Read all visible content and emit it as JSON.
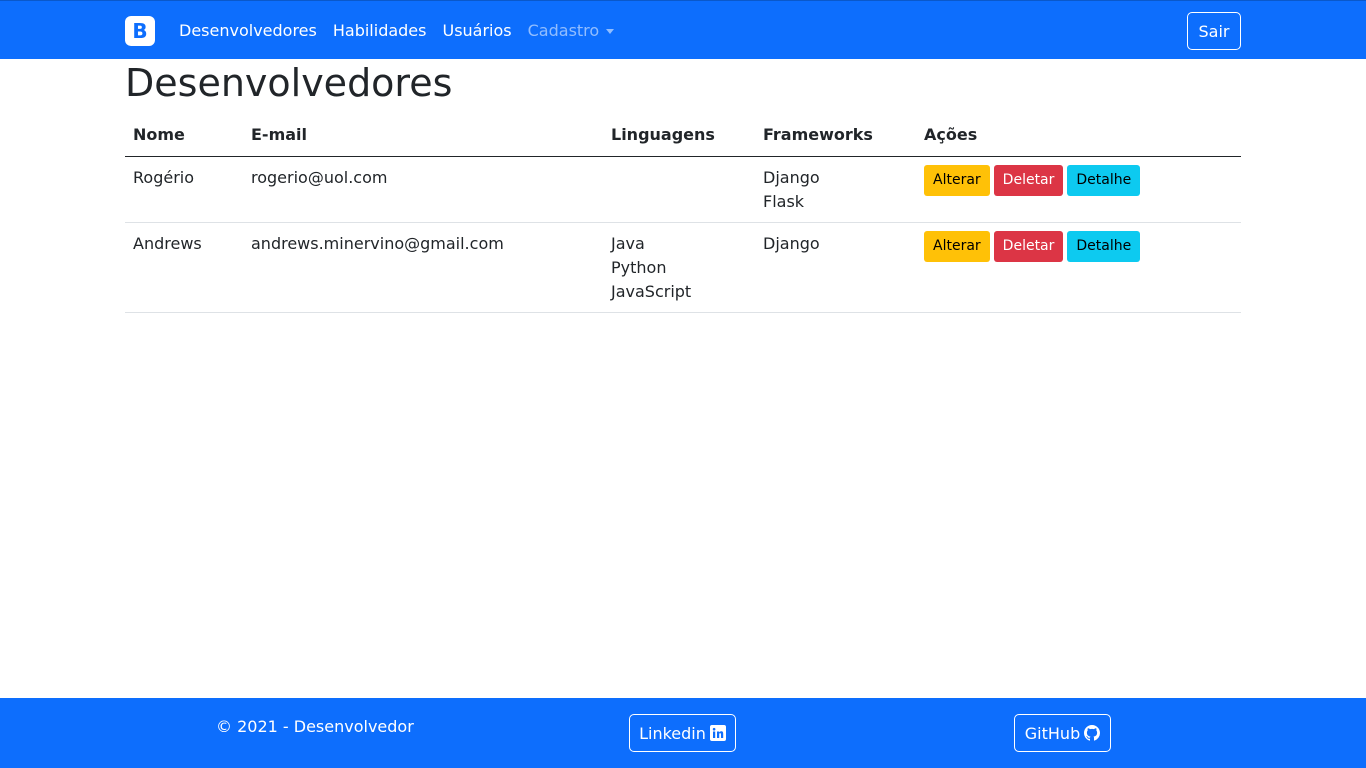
{
  "navbar": {
    "brand": "B",
    "links": [
      "Desenvolvedores",
      "Habilidades",
      "Usuários"
    ],
    "dropdown_label": "Cadastro",
    "logout_label": "Sair"
  },
  "page": {
    "title": "Desenvolvedores"
  },
  "table": {
    "headers": [
      "Nome",
      "E-mail",
      "Linguagens",
      "Frameworks",
      "Ações"
    ],
    "rows": [
      {
        "nome": "Rogério",
        "email": "rogerio@uol.com",
        "linguagens": [],
        "frameworks": [
          "Django",
          "Flask"
        ]
      },
      {
        "nome": "Andrews",
        "email": "andrews.minervino@gmail.com",
        "linguagens": [
          "Java",
          "Python",
          "JavaScript"
        ],
        "frameworks": [
          "Django"
        ]
      }
    ],
    "actions": {
      "edit": "Alterar",
      "delete": "Deletar",
      "detail": "Detalhe"
    }
  },
  "footer": {
    "copyright": "© 2021 - Desenvolvedor",
    "linkedin_label": "Linkedin",
    "github_label": "GitHub"
  },
  "colors": {
    "primary": "#0d6efd",
    "warning": "#ffc107",
    "danger": "#dc3545",
    "info": "#0dcaf0"
  },
  "icons": [
    "linkedin-icon",
    "github-icon",
    "chevron-down-icon"
  ]
}
